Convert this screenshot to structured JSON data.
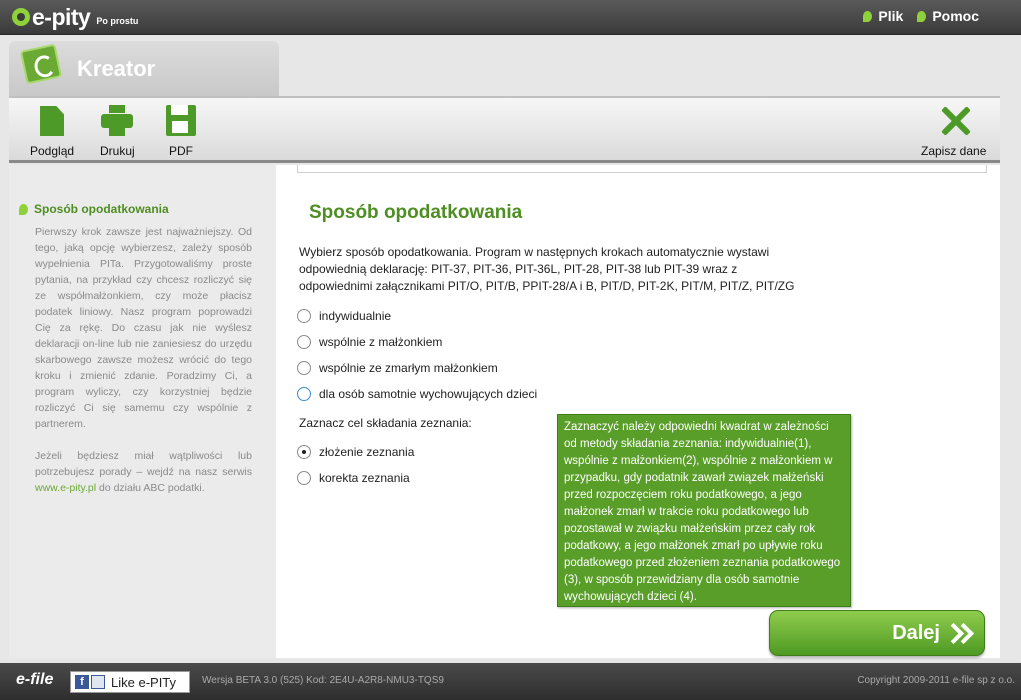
{
  "header": {
    "logo_text": "e-pity",
    "logo_subtitle": "Po prostu",
    "menu": [
      {
        "label": "Plik",
        "icon": "leaf-icon"
      },
      {
        "label": "Pomoc",
        "icon": "leaf-icon"
      }
    ]
  },
  "tab": {
    "title": "Kreator",
    "icon": "e-badge-icon"
  },
  "toolbar": {
    "preview_label": "Podgląd",
    "print_label": "Drukuj",
    "pdf_label": "PDF",
    "save_label": "Zapisz dane"
  },
  "sidebar": {
    "heading": "Sposób opodatkowania",
    "paragraph1": "Pierwszy krok zawsze jest najważniejszy. Od tego, jaką opcję wybierzesz, zależy sposób wypełnienia PITa. Przygotowaliśmy proste pytania, na przykład czy chcesz rozliczyć się ze współmałżonkiem, czy może płacisz podatek liniowy. Nasz program poprowadzi Cię za rękę. Do czasu jak nie wyślesz deklaracji on-line lub nie zaniesiesz do urzędu skarbowego zawsze możesz wrócić do tego kroku i zmienić zdanie. Poradzimy Ci, a program wyliczy, czy korzystniej będzie rozliczyć Ci się samemu czy wspólnie z partnerem.",
    "paragraph2_before": "Jeżeli będziesz miał wątpliwości lub potrzebujesz porady – wejdź na nasz serwis ",
    "paragraph2_link": "www.e-pity.pl",
    "paragraph2_after": " do działu ABC podatki."
  },
  "main": {
    "title": "Sposób opodatkowania",
    "description": "Wybierz sposób opodatkowania. Program w następnych krokach automatycznie wystawi odpowiednią deklarację: PIT-37, PIT-36, PIT-36L, PIT-28, PIT-38 lub PIT-39 wraz z odpowiednimi załącznikami PIT/O, PIT/B, PPIT-28/A i B, PIT/D, PIT-2K, PIT/M, PIT/Z, PIT/ZG",
    "taxation_options": [
      {
        "label": "indywidualnie",
        "checked": false
      },
      {
        "label": "wspólnie z małżonkiem",
        "checked": false
      },
      {
        "label": "wspólnie ze zmarłym małżonkiem",
        "checked": false
      },
      {
        "label": "dla osób samotnie wychowujących dzieci",
        "checked": false
      }
    ],
    "purpose_label": "Zaznacz cel składania zeznania:",
    "purpose_options": [
      {
        "label": "złożenie zeznania",
        "checked": true
      },
      {
        "label": "korekta zeznania",
        "checked": false
      }
    ],
    "tooltip": "Zaznaczyć należy odpowiedni kwadrat w zależności od metody składania zeznania: indywidualnie(1), wspólnie z małżonkiem(2), wspólnie z małżonkiem w przypadku, gdy podatnik zawarł związek małżeński przed rozpoczęciem roku podatkowego, a jego małżonek zmarł w trakcie roku podatkowego lub pozostawał w związku małżeńskim przez cały rok podatkowy, a jego małżonek zmarł po upływie roku podatkowego przed złożeniem zeznania podatkowego (3), w sposób przewidziany dla osób samotnie wychowujących dzieci (4).",
    "next_label": "Dalej"
  },
  "footer": {
    "logo": "e-file",
    "like_label": "Like e-PITy",
    "version": "Wersja BETA 3.0 (525)  Kod: 2E4U-A2R8-NMU3-TQS9",
    "copyright": "Copyright 2009-2011 e-file sp z o.o."
  },
  "colors": {
    "accent_green": "#4e8e22",
    "tooltip_green": "#5a9e2a",
    "topbar": "#3a3a3a"
  }
}
